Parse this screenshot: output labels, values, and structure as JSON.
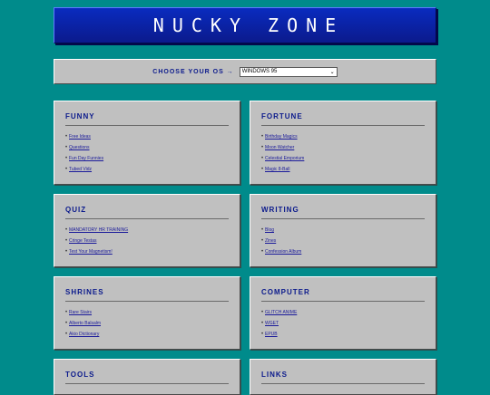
{
  "banner": {
    "title": "NUCKY ZONE"
  },
  "os_picker": {
    "label": "CHOOSE YOUR OS →",
    "selected": "WINDOWS 95"
  },
  "sections": [
    {
      "title": "FUNNY",
      "links": [
        "Free Ideas",
        "Questions",
        "Fun Day Funnies",
        "Tubed Vidz"
      ]
    },
    {
      "title": "FORTUNE",
      "links": [
        "Birthday Magics",
        "Moon Watcher",
        "Celestial Emporium",
        "Magic 8-Ball"
      ]
    },
    {
      "title": "QUIZ",
      "links": [
        "MANDATORY HR TRAINING",
        "Cringe Testas",
        "Test Your Magnetism!"
      ]
    },
    {
      "title": "WRITING",
      "links": [
        "Blog",
        "Zines",
        "Confession Album"
      ]
    },
    {
      "title": "SHRINES",
      "links": [
        "Rare Stairs",
        "Alberto Balsalm",
        "Akio Dictionary"
      ]
    },
    {
      "title": "COMPUTER",
      "links": [
        "GLITCH ANIME",
        "WGET",
        "EPUB"
      ]
    },
    {
      "title": "TOOLS",
      "links": []
    },
    {
      "title": "LINKS",
      "links": []
    }
  ]
}
